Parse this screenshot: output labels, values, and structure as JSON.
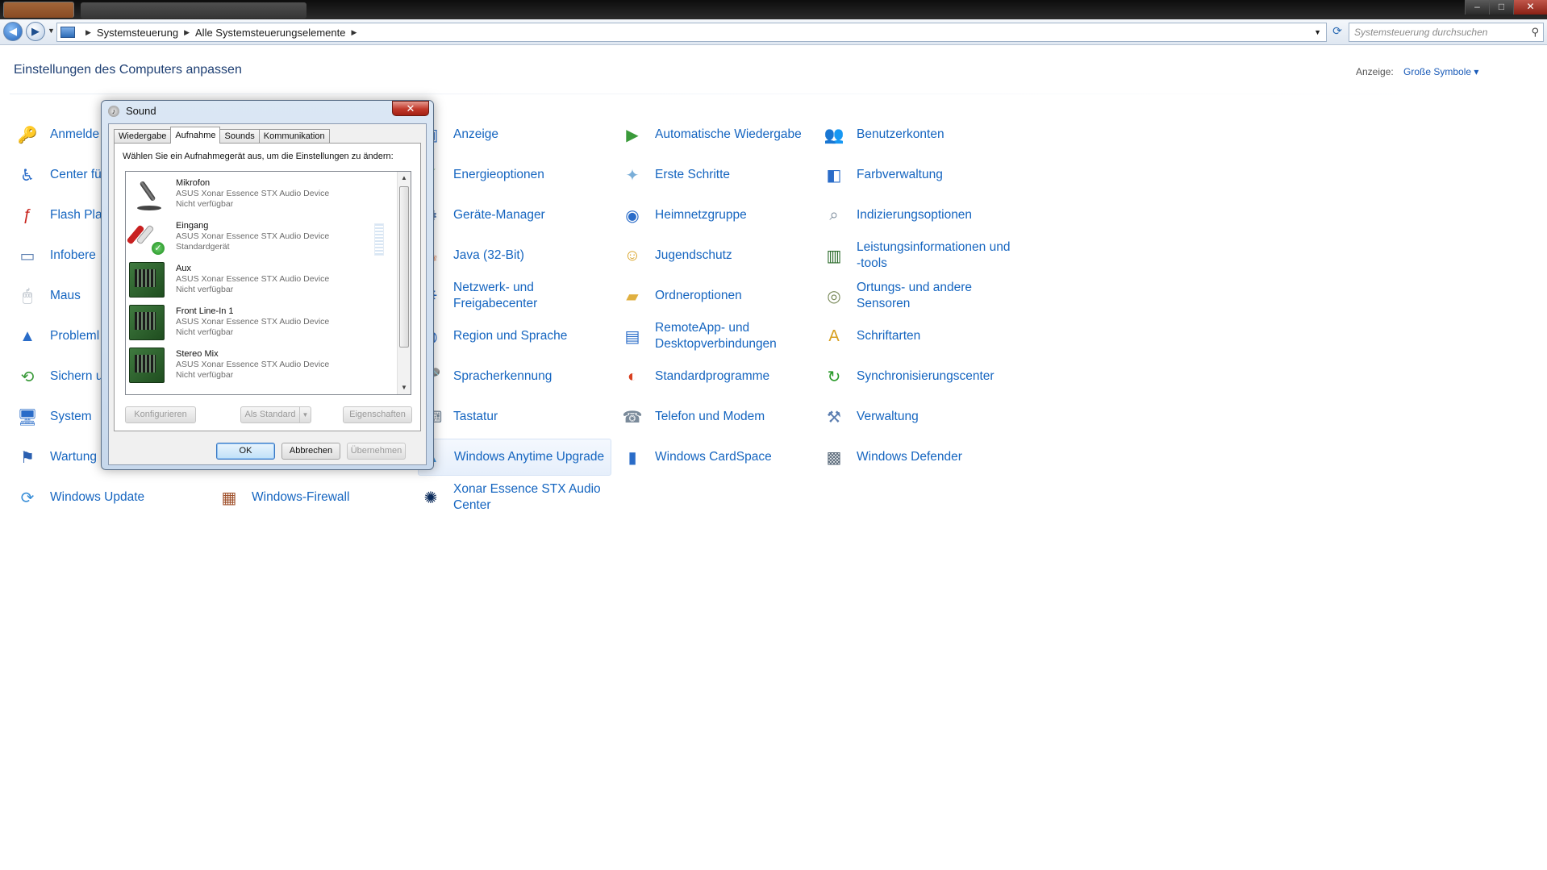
{
  "window": {
    "controls": {
      "minimize": "–",
      "maximize": "□",
      "close": "✕"
    }
  },
  "address_bar": {
    "breadcrumbs": [
      "Systemsteuerung",
      "Alle Systemsteuerungselemente"
    ],
    "search_placeholder": "Systemsteuerung durchsuchen",
    "icons": {
      "back": "back-arrow-icon",
      "forward": "forward-arrow-icon",
      "refresh": "refresh-icon",
      "search": "search-icon"
    }
  },
  "header": {
    "title": "Einstellungen des Computers anpassen",
    "view_label": "Anzeige:",
    "view_value": "Große Symbole ▾"
  },
  "items": [
    {
      "label": "Anmelde",
      "icon": "credential-icon",
      "color": "#c9a227"
    },
    {
      "label": "Center fü Bedienun",
      "icon": "ease-of-access-icon",
      "color": "#2a6cc8"
    },
    {
      "label": "Flash Pla",
      "icon": "flash-icon",
      "color": "#c8231c"
    },
    {
      "label": "Infobere",
      "icon": "notification-area-icon",
      "color": "#5a7db0"
    },
    {
      "label": "Maus",
      "icon": "mouse-icon",
      "color": "#9aa5b2"
    },
    {
      "label": "Probleml",
      "icon": "troubleshooting-icon",
      "color": "#2a6cc8"
    },
    {
      "label": "Sichern u Wiederhe",
      "icon": "backup-icon",
      "color": "#3a9a3a"
    },
    {
      "label": "System",
      "icon": "system-icon",
      "color": "#2a6cc8"
    },
    {
      "label": "Wartung",
      "icon": "action-center-flag-icon",
      "color": "#2a5fb0"
    },
    {
      "label": "Windows Update",
      "icon": "windows-update-icon",
      "color": "#3a8fd8"
    },
    {
      "label": "Windows-Firewall",
      "icon": "firewall-icon",
      "color": "#a0522d"
    },
    {
      "label": "Anzeige",
      "icon": "display-icon",
      "color": "#2a6cc8"
    },
    {
      "label": "Energieoptionen",
      "icon": "power-options-icon",
      "color": "#3a9a3a"
    },
    {
      "label": "Geräte-Manager",
      "icon": "device-manager-icon",
      "color": "#5a7db0"
    },
    {
      "label": "Java (32-Bit)",
      "icon": "java-icon",
      "color": "#c8501c"
    },
    {
      "label": "Netzwerk- und Freigabecenter",
      "icon": "network-icon",
      "color": "#2a6cc8"
    },
    {
      "label": "Region und Sprache",
      "icon": "region-icon",
      "color": "#2a6cc8"
    },
    {
      "label": "Spracherkennung",
      "icon": "speech-icon",
      "color": "#7a8a9a"
    },
    {
      "label": "Tastatur",
      "icon": "keyboard-icon",
      "color": "#7a8a9a"
    },
    {
      "label": "Windows Anytime Upgrade",
      "icon": "anytime-upgrade-icon",
      "color": "#3a8fd8"
    },
    {
      "label": "Xonar Essence STX Audio Center",
      "icon": "xonar-audio-icon",
      "color": "#0a2a5a"
    },
    {
      "label": "Automatische Wiedergabe",
      "icon": "autoplay-icon",
      "color": "#3a9a3a"
    },
    {
      "label": "Erste Schritte",
      "icon": "getting-started-icon",
      "color": "#7aaed8"
    },
    {
      "label": "Heimnetzgruppe",
      "icon": "homegroup-icon",
      "color": "#2a6cc8"
    },
    {
      "label": "Jugendschutz",
      "icon": "parental-controls-icon",
      "color": "#d8a020"
    },
    {
      "label": "Ordneroptionen",
      "icon": "folder-options-icon",
      "color": "#e0b040"
    },
    {
      "label": "RemoteApp- und Desktopverbindungen",
      "icon": "remoteapp-icon",
      "color": "#2a6cc8"
    },
    {
      "label": "Standardprogramme",
      "icon": "default-programs-icon",
      "color": "#d84020"
    },
    {
      "label": "Telefon und Modem",
      "icon": "phone-modem-icon",
      "color": "#7a8a9a"
    },
    {
      "label": "Windows CardSpace",
      "icon": "cardspace-icon",
      "color": "#2a6cc8"
    },
    {
      "label": "Benutzerkonten",
      "icon": "user-accounts-icon",
      "color": "#8a7a5a"
    },
    {
      "label": "Farbverwaltung",
      "icon": "color-management-icon",
      "color": "#2a6cc8"
    },
    {
      "label": "Indizierungsoptionen",
      "icon": "indexing-icon",
      "color": "#7a8a9a"
    },
    {
      "label": "Leistungsinformationen und -tools",
      "icon": "performance-icon",
      "color": "#2a6a2a"
    },
    {
      "label": "Ortungs- und andere Sensoren",
      "icon": "location-sensor-icon",
      "color": "#7a8a5a"
    },
    {
      "label": "Schriftarten",
      "icon": "fonts-icon",
      "color": "#d8a020"
    },
    {
      "label": "Synchronisierungscenter",
      "icon": "sync-center-icon",
      "color": "#2a9a2a"
    },
    {
      "label": "Verwaltung",
      "icon": "administrative-tools-icon",
      "color": "#5a7db0"
    },
    {
      "label": "Windows Defender",
      "icon": "windows-defender-icon",
      "color": "#5a6a7a"
    }
  ],
  "sound_dialog": {
    "title": "Sound",
    "close_glyph": "✕",
    "tabs": [
      "Wiedergabe",
      "Aufnahme",
      "Sounds",
      "Kommunikation"
    ],
    "active_tab": "Aufnahme",
    "instruction": "Wählen Sie ein Aufnahmegerät aus, um die Einstellungen zu ändern:",
    "devices": [
      {
        "name": "Mikrofon",
        "driver": "ASUS Xonar Essence STX Audio Device",
        "status": "Nicht verfügbar",
        "icon": "microphone-icon"
      },
      {
        "name": "Eingang",
        "driver": "ASUS Xonar Essence STX Audio Device",
        "status": "Standardgerät",
        "icon": "line-in-cable-icon"
      },
      {
        "name": "Aux",
        "driver": "ASUS Xonar Essence STX Audio Device",
        "status": "Nicht verfügbar",
        "icon": "sound-card-icon"
      },
      {
        "name": "Front Line-In 1",
        "driver": "ASUS Xonar Essence STX Audio Device",
        "status": "Nicht verfügbar",
        "icon": "sound-card-icon"
      },
      {
        "name": "Stereo Mix",
        "driver": "ASUS Xonar Essence STX Audio Device",
        "status": "Nicht verfügbar",
        "icon": "sound-card-icon"
      }
    ],
    "buttons": {
      "configure": "Konfigurieren",
      "set_default": "Als Standard",
      "properties": "Eigenschaften",
      "ok": "OK",
      "cancel": "Abbrechen",
      "apply": "Übernehmen"
    }
  }
}
